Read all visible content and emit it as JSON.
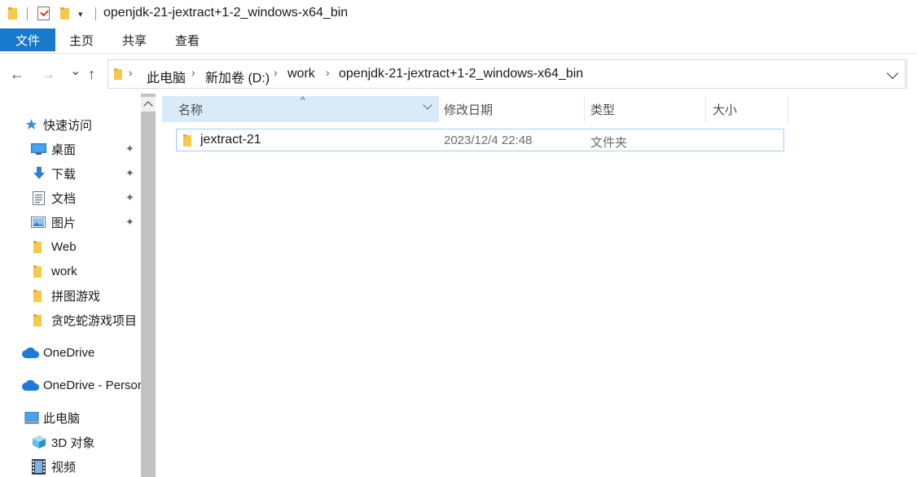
{
  "window": {
    "title": "openjdk-21-jextract+1-2_windows-x64_bin",
    "qa_dropdown_glyph": "▾"
  },
  "ribbon": {
    "tabs": [
      {
        "label": "文件",
        "active": true
      },
      {
        "label": "主页"
      },
      {
        "label": "共享"
      },
      {
        "label": "查看"
      }
    ]
  },
  "nav": {
    "back_icon": "←",
    "forward_icon": "→",
    "recent_icon": "⌄",
    "up_icon": "↑"
  },
  "address": {
    "crumbs": [
      "此电脑",
      "新加卷 (D:)",
      "work",
      "openjdk-21-jextract+1-2_windows-x64_bin"
    ],
    "separator": "›"
  },
  "sidebar": {
    "quick_access": "快速访问",
    "items": [
      {
        "label": "桌面",
        "icon": "desktop-icon",
        "pinned": true
      },
      {
        "label": "下载",
        "icon": "download-icon",
        "pinned": true
      },
      {
        "label": "文档",
        "icon": "document-icon",
        "pinned": true
      },
      {
        "label": "图片",
        "icon": "picture-icon",
        "pinned": true
      },
      {
        "label": "Web",
        "icon": "folder-icon"
      },
      {
        "label": "work",
        "icon": "folder-icon"
      },
      {
        "label": "拼图游戏",
        "icon": "folder-icon"
      },
      {
        "label": "贪吃蛇游戏项目",
        "icon": "folder-icon"
      }
    ],
    "onedrive": "OneDrive",
    "onedrive_personal": "OneDrive - Personal",
    "this_pc": "此电脑",
    "objects3d": "3D 对象",
    "videos": "视频",
    "pin_glyph": "📌"
  },
  "columns": {
    "name": "名称",
    "modified": "修改日期",
    "type": "类型",
    "size": "大小",
    "sort_caret": "^"
  },
  "files": [
    {
      "name": "jextract-21",
      "modified": "2023/12/4 22:48",
      "type": "文件夹"
    }
  ],
  "colors": {
    "accent": "#1979ca",
    "folder": "#f5c94b",
    "selection_border": "#99d1ff",
    "header_hover": "#d9ebf9"
  }
}
